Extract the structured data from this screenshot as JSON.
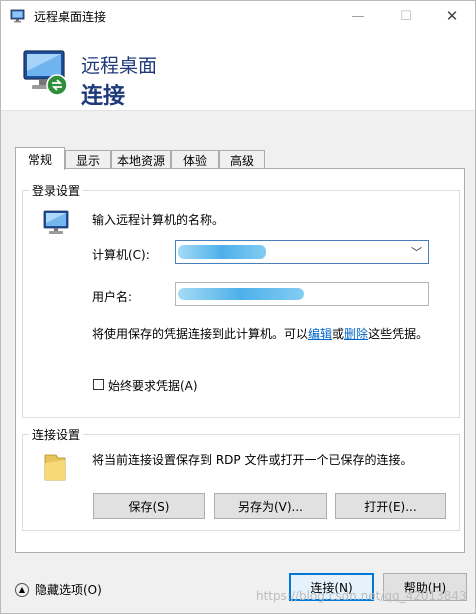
{
  "window": {
    "title": "远程桌面连接",
    "controls": {
      "minimize": "—",
      "maximize": "☐",
      "close": "✕"
    }
  },
  "banner": {
    "line1": "远程桌面",
    "line2": "连接"
  },
  "tabs": [
    {
      "label": "常规",
      "active": true
    },
    {
      "label": "显示",
      "active": false
    },
    {
      "label": "本地资源",
      "active": false
    },
    {
      "label": "体验",
      "active": false
    },
    {
      "label": "高级",
      "active": false
    }
  ],
  "login": {
    "group_label": "登录设置",
    "prompt": "输入远程计算机的名称。",
    "computer_label": "计算机(C):",
    "computer_value": "",
    "username_label": "用户名:",
    "username_value": "",
    "note_prefix": "将使用保存的凭据连接到此计算机。可以",
    "note_edit": "编辑",
    "note_or": "或",
    "note_delete": "删除",
    "note_suffix": "这些凭据。",
    "always_ask_label": "始终要求凭据(A)",
    "always_ask_checked": false
  },
  "connection": {
    "group_label": "连接设置",
    "description": "将当前连接设置保存到 RDP 文件或打开一个已保存的连接。",
    "save": "保存(S)",
    "save_as": "另存为(V)...",
    "open": "打开(E)..."
  },
  "footer": {
    "hide_options": "隐藏选项(O)",
    "connect": "连接(N)",
    "help": "帮助(H)",
    "watermark": "https://blog.csdn.net/qq_42013843"
  },
  "colors": {
    "accent": "#0078d7",
    "banner_text": "#1f3a7a",
    "link": "#0066cc"
  }
}
